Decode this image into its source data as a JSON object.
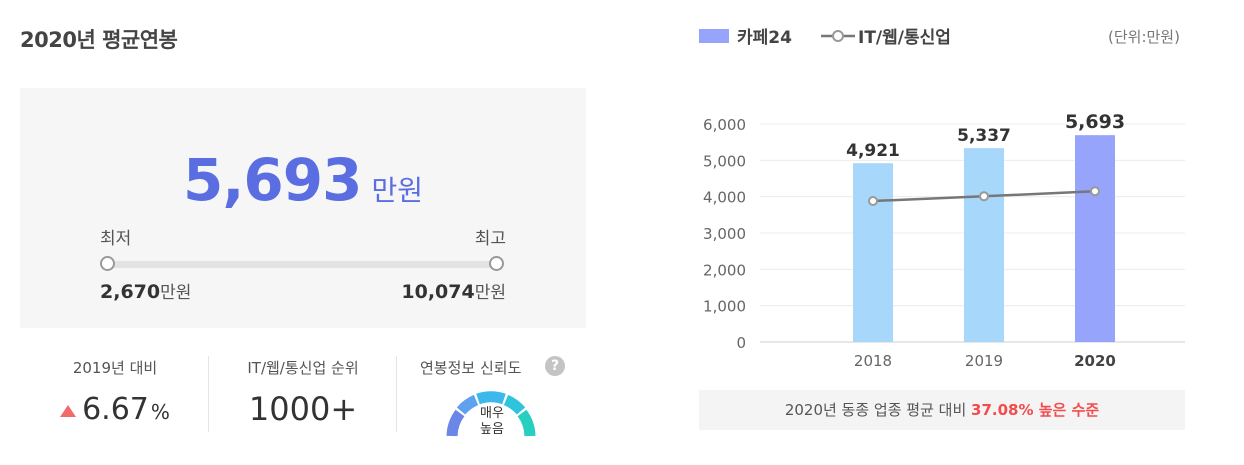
{
  "title": "2020년 평균연봉",
  "salary": {
    "value": "5,693",
    "unit": "만원",
    "min_label": "최저",
    "max_label": "최고",
    "min_value": "2,670",
    "max_value": "10,074",
    "value_unit": "만원"
  },
  "stats": {
    "yoy_label": "2019년 대비",
    "yoy_value": "6.67",
    "yoy_unit": "%",
    "rank_label": "IT/웹/통신업 순위",
    "rank_value": "1000+",
    "reliability_label": "연봉정보 신뢰도",
    "help_glyph": "?",
    "reliability_value_line1": "매우",
    "reliability_value_line2": "높음"
  },
  "legend": {
    "company": "카페24",
    "industry": "IT/웹/통신업"
  },
  "unit_note": "(단위:만원)",
  "note": {
    "prefix": "2020년 동종 업종 평균 대비",
    "highlight": "37.08% 높은 수준"
  },
  "colors": {
    "accent": "#5b6ee1",
    "bar_light": "#a7d8fb",
    "bar_current": "#96a5fb",
    "line": "#777777",
    "up_red": "#f26b6b",
    "highlight_red": "#f24c4c"
  },
  "chart_data": {
    "type": "bar",
    "categories": [
      "2018",
      "2019",
      "2020"
    ],
    "series": [
      {
        "name": "카페24",
        "type": "bar",
        "values": [
          4921,
          5337,
          5693
        ],
        "labels": [
          "4,921",
          "5,337",
          "5,693"
        ]
      },
      {
        "name": "IT/웹/통신업",
        "type": "line",
        "values": [
          3880,
          4010,
          4150
        ]
      }
    ],
    "yticks": [
      "6,000",
      "5,000",
      "4,000",
      "3,000",
      "2,000",
      "1,000",
      "0"
    ],
    "ylim": [
      0,
      6000
    ],
    "grid": true
  }
}
